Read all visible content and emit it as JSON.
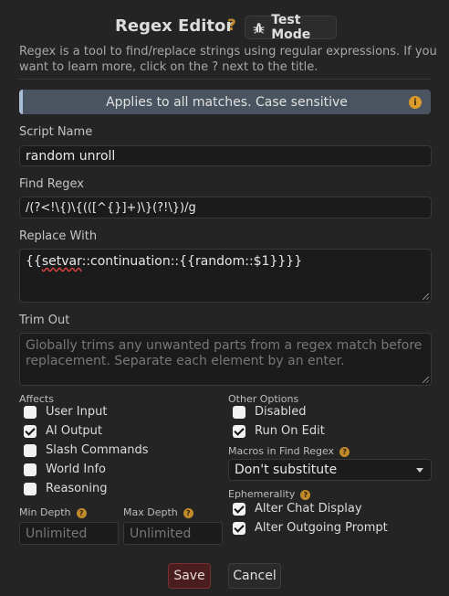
{
  "header": {
    "title": "Regex Editor",
    "help": "?",
    "test_mode_label": "Test Mode"
  },
  "intro": "Regex is a tool to find/replace strings using regular expressions. If you want to learn more, click on the ? next to the title.",
  "banner": {
    "text": "Applies to all matches. Case sensitive",
    "info": "i"
  },
  "script_name": {
    "label": "Script Name",
    "value": "random unroll"
  },
  "find_regex": {
    "label": "Find Regex",
    "value": "/(?<!\\{)\\{(([^{}]+)\\}(?!\\})/g"
  },
  "replace_with": {
    "label": "Replace With",
    "value_prefix": "{{",
    "value_squiggle": "setvar",
    "value_rest": "::continuation::{{random::$1}}}}"
  },
  "trim_out": {
    "label": "Trim Out",
    "placeholder": "Globally trims any unwanted parts from a regex match before replacement. Separate each element by an enter."
  },
  "affects": {
    "label": "Affects",
    "options": [
      {
        "label": "User Input",
        "checked": false
      },
      {
        "label": "AI Output",
        "checked": true
      },
      {
        "label": "Slash Commands",
        "checked": false
      },
      {
        "label": "World Info",
        "checked": false
      },
      {
        "label": "Reasoning",
        "checked": false
      }
    ]
  },
  "other_options": {
    "label": "Other Options",
    "options": [
      {
        "label": "Disabled",
        "checked": false
      },
      {
        "label": "Run On Edit",
        "checked": true
      }
    ]
  },
  "macros": {
    "label": "Macros in Find Regex",
    "help": "?",
    "selected": "Don't substitute"
  },
  "ephemerality": {
    "label": "Ephemerality",
    "help": "?",
    "options": [
      {
        "label": "Alter Chat Display",
        "checked": true
      },
      {
        "label": "Alter Outgoing Prompt",
        "checked": true
      }
    ]
  },
  "depth": {
    "min_label": "Min Depth",
    "min_placeholder": "Unlimited",
    "max_label": "Max Depth",
    "max_placeholder": "Unlimited",
    "help": "?"
  },
  "buttons": {
    "save": "Save",
    "cancel": "Cancel"
  }
}
